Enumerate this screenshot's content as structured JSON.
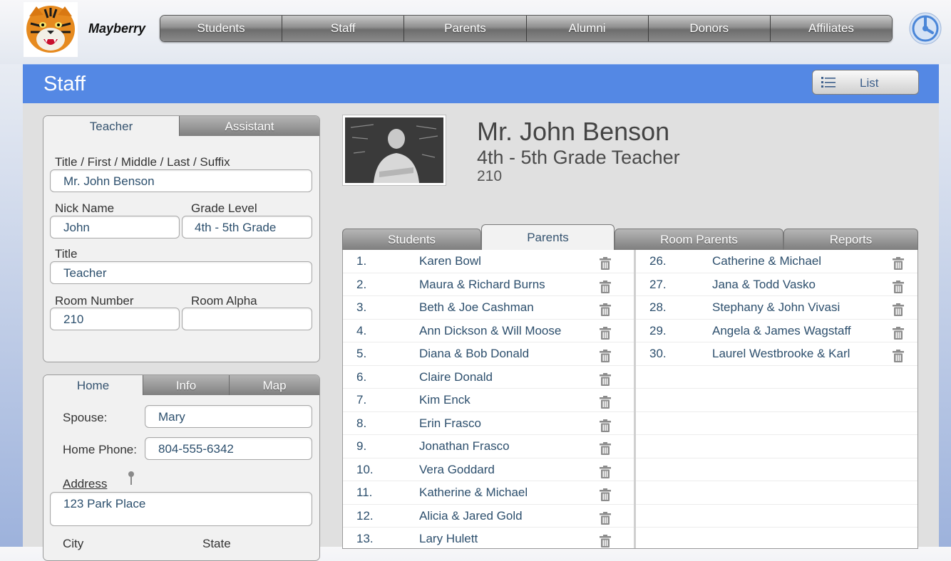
{
  "brand": {
    "name": "Mayberry"
  },
  "nav": [
    {
      "label": "Students"
    },
    {
      "label": "Staff"
    },
    {
      "label": "Parents"
    },
    {
      "label": "Alumni"
    },
    {
      "label": "Donors"
    },
    {
      "label": "Affiliates"
    }
  ],
  "panel": {
    "title": "Staff",
    "list_button": "List"
  },
  "teacher_card": {
    "tabs": [
      {
        "label": "Teacher"
      },
      {
        "label": "Assistant"
      }
    ],
    "name_label": "Title / First / Middle / Last / Suffix",
    "name_value": "Mr. John Benson",
    "nick_label": "Nick Name",
    "nick_value": "John",
    "grade_label": "Grade Level",
    "grade_value": "4th - 5th Grade",
    "title_label": "Title",
    "title_value": "Teacher",
    "room_number_label": "Room Number",
    "room_number_value": "210",
    "room_alpha_label": "Room Alpha",
    "room_alpha_value": ""
  },
  "home_card": {
    "tabs": [
      {
        "label": "Home"
      },
      {
        "label": "Info"
      },
      {
        "label": "Map"
      }
    ],
    "spouse_label": "Spouse:",
    "spouse_value": "Mary",
    "phone_label": "Home Phone:",
    "phone_value": "804-555-6342",
    "address_label": "Address",
    "address_value": "123 Park Place",
    "city_label": "City",
    "state_label": "State"
  },
  "profile": {
    "name": "Mr. John Benson",
    "role": "4th - 5th Grade Teacher",
    "room": "210"
  },
  "list_tabs": [
    {
      "label": "Students"
    },
    {
      "label": "Parents"
    },
    {
      "label": "Room Parents"
    },
    {
      "label": "Reports"
    }
  ],
  "parents_left": [
    {
      "num": "1.",
      "name": "Karen Bowl"
    },
    {
      "num": "2.",
      "name": "Maura & Richard Burns"
    },
    {
      "num": "3.",
      "name": "Beth & Joe Cashman"
    },
    {
      "num": "4.",
      "name": "Ann Dickson & Will Moose"
    },
    {
      "num": "5.",
      "name": "Diana & Bob Donald"
    },
    {
      "num": "6.",
      "name": "Claire Donald"
    },
    {
      "num": "7.",
      "name": "Kim Enck"
    },
    {
      "num": "8.",
      "name": "Erin Frasco"
    },
    {
      "num": "9.",
      "name": "Jonathan Frasco"
    },
    {
      "num": "10.",
      "name": "Vera Goddard"
    },
    {
      "num": "11.",
      "name": "Katherine & Michael"
    },
    {
      "num": "12.",
      "name": "Alicia & Jared Gold"
    },
    {
      "num": "13.",
      "name": "Lary Hulett"
    }
  ],
  "parents_right": [
    {
      "num": "26.",
      "name": "Catherine & Michael"
    },
    {
      "num": "27.",
      "name": "Jana & Todd Vasko"
    },
    {
      "num": "28.",
      "name": "Stephany & John Vivasi"
    },
    {
      "num": "29.",
      "name": "Angela & James Wagstaff"
    },
    {
      "num": "30.",
      "name": "Laurel Westbrooke & Karl"
    }
  ],
  "colors": {
    "header_blue": "#5488e4",
    "text_blue": "#2d4f6d"
  }
}
